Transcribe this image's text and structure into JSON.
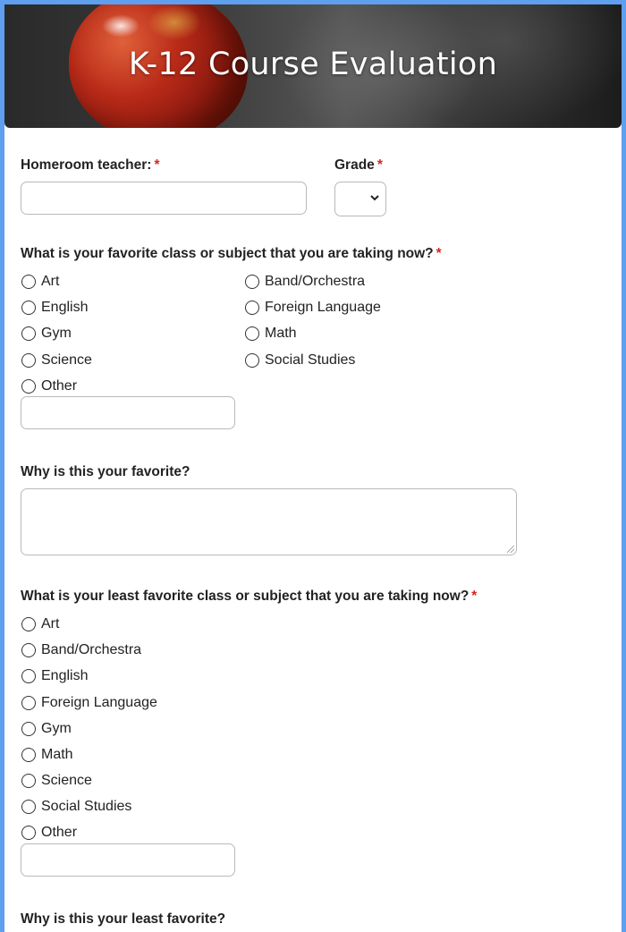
{
  "header": {
    "title": "K-12 Course Evaluation"
  },
  "fields": {
    "homeroom_label": "Homeroom teacher:",
    "grade_label": "Grade",
    "required_mark": "*",
    "favorite_label": "What is your favorite class or subject that you are taking now?",
    "favorite_options": [
      "Art",
      "Band/Orchestra",
      "English",
      "Foreign Language",
      "Gym",
      "Math",
      "Science",
      "Social Studies",
      "Other"
    ],
    "why_favorite_label": "Why is this your favorite?",
    "least_label": "What is your least favorite class or subject that you are taking now?",
    "least_options": [
      "Art",
      "Band/Orchestra",
      "English",
      "Foreign Language",
      "Gym",
      "Math",
      "Science",
      "Social Studies",
      "Other"
    ],
    "why_least_label": "Why is this your least favorite?"
  },
  "icons": {
    "select_arrow": "chevron-down-icon"
  },
  "colors": {
    "accent": "#5e9ff0",
    "required": "#d9261c"
  }
}
